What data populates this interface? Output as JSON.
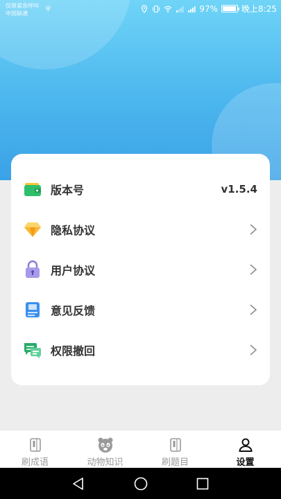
{
  "status_bar": {
    "carrier_line1": "仅限紧急呼叫",
    "carrier_line2": "中国联通",
    "battery": "97%",
    "time": "晚上8:25"
  },
  "settings": {
    "items": [
      {
        "label": "版本号",
        "value": "v1.5.4",
        "icon": "wallet-icon"
      },
      {
        "label": "隐私协议",
        "icon": "diamond-icon"
      },
      {
        "label": "用户协议",
        "icon": "lock-icon"
      },
      {
        "label": "意见反馈",
        "icon": "notebook-icon"
      },
      {
        "label": "权限撤回",
        "icon": "chat-bubbles-icon"
      }
    ]
  },
  "tabs": [
    {
      "label": "刷成语",
      "icon": "book-icon",
      "active": false
    },
    {
      "label": "动物知识",
      "icon": "panda-icon",
      "active": false
    },
    {
      "label": "刷题目",
      "icon": "book-icon",
      "active": false
    },
    {
      "label": "设置",
      "icon": "user-icon",
      "active": true
    }
  ],
  "colors": {
    "header_top": "#6fd4f7",
    "header_bottom": "#3aa2e6",
    "tab_active": "#111111",
    "tab_inactive": "#9a9a9a"
  }
}
